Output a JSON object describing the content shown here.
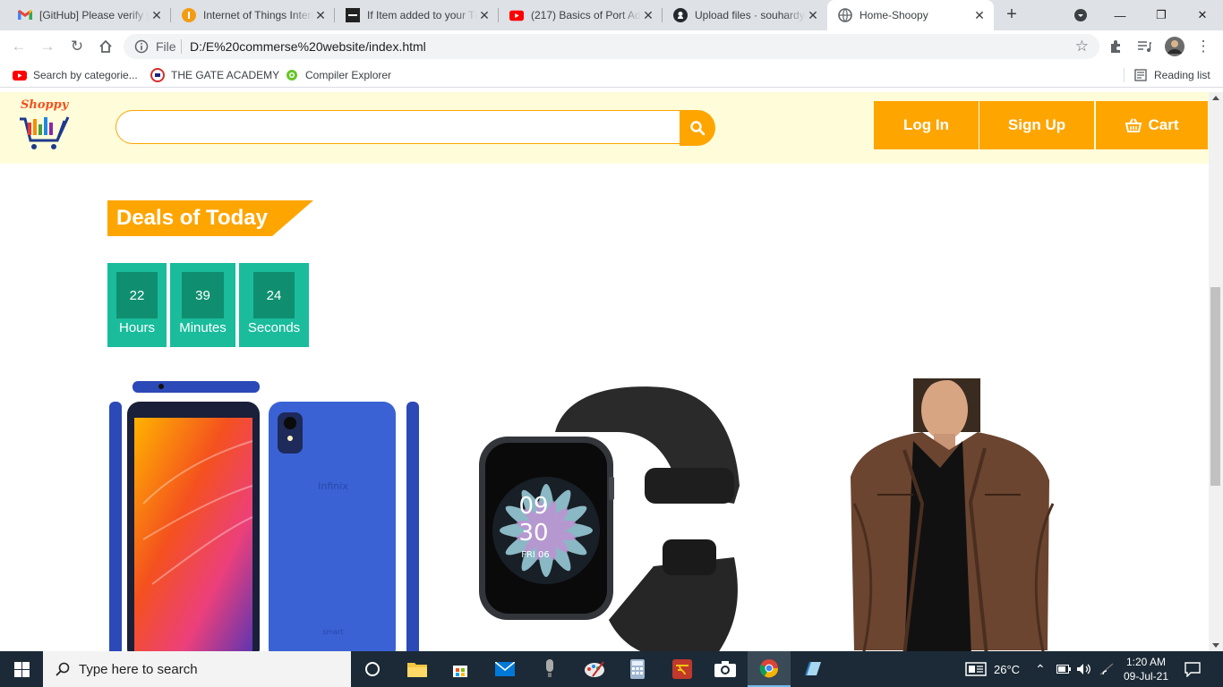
{
  "browser": {
    "tabs": [
      {
        "title": "[GitHub] Please verify your device",
        "favicon": "gmail-icon"
      },
      {
        "title": "Internet of Things Intern",
        "favicon": "iot-icon"
      },
      {
        "title": "If Item added to your Trolley",
        "favicon": "ifttt-icon"
      },
      {
        "title": "(217) Basics of Port Address",
        "favicon": "youtube-icon"
      },
      {
        "title": "Upload files · souhardya",
        "favicon": "github-icon"
      },
      {
        "title": "Home-Shoopy",
        "favicon": "globe-icon",
        "active": true
      }
    ],
    "address": {
      "scheme_label": "File",
      "url": "D:/E%20commerse%20website/index.html"
    },
    "bookmarks": [
      {
        "label": "Search by categorie...",
        "icon": "youtube-icon"
      },
      {
        "label": "THE GATE ACADEMY",
        "icon": "gate-academy-icon"
      },
      {
        "label": "Compiler Explorer",
        "icon": "compiler-explorer-icon"
      }
    ],
    "reading_list": "Reading list"
  },
  "site": {
    "brand": "Shoppy",
    "search": {
      "value": "",
      "placeholder": ""
    },
    "nav": {
      "login": "Log In",
      "signup": "Sign Up",
      "cart": "Cart"
    },
    "deals_title": "Deals of Today",
    "countdown": [
      {
        "value": "22",
        "label": "Hours"
      },
      {
        "value": "39",
        "label": "Minutes"
      },
      {
        "value": "24",
        "label": "Seconds"
      }
    ],
    "phone_brand": "Infinix",
    "phone_model": "smart",
    "watch": {
      "hour": "09",
      "minute": "30",
      "date": "FRI 06"
    },
    "colors": {
      "accent": "#ffa500",
      "header_bg": "#fffcd9",
      "countdown": "#1abc9c",
      "countdown_dark": "#0f8f70"
    }
  },
  "taskbar": {
    "search_placeholder": "Type here to search",
    "weather": "26°C",
    "time": "1:20 AM",
    "date": "09-Jul-21"
  }
}
